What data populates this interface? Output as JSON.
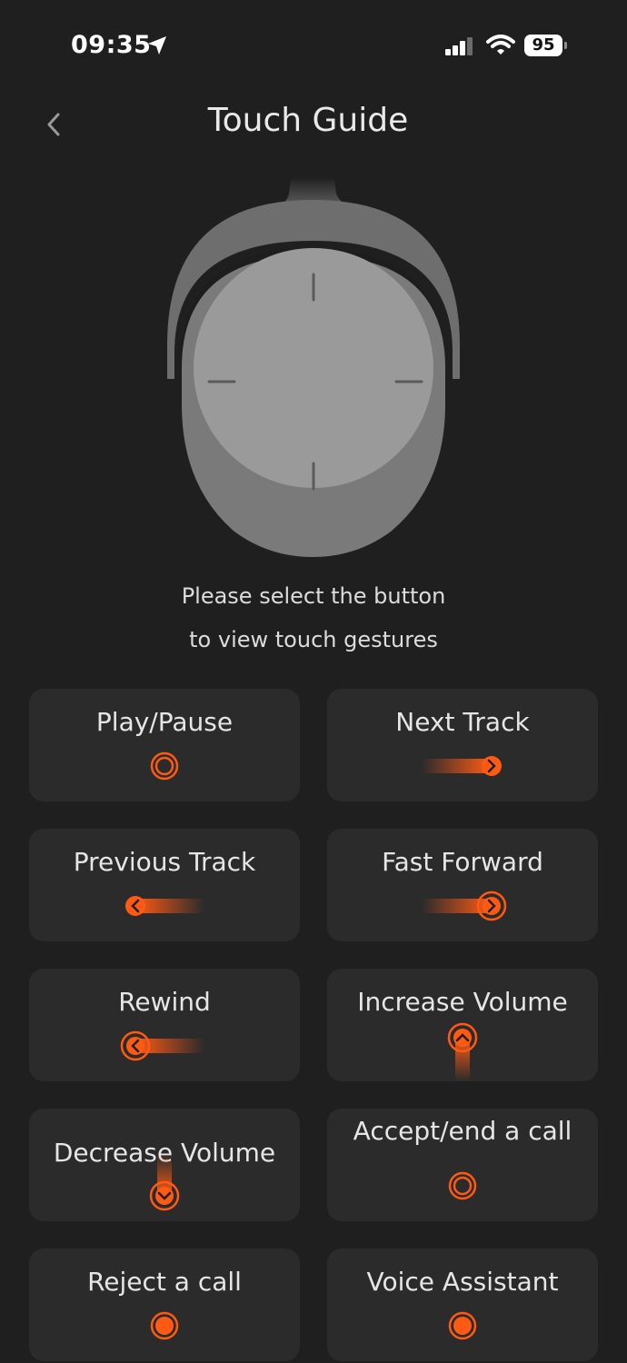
{
  "status_bar": {
    "time": "09:35",
    "battery": "95"
  },
  "header": {
    "title": "Touch Guide"
  },
  "hint": {
    "line1": "Please select the button",
    "line2": "to view touch gestures"
  },
  "gestures": [
    {
      "label": "Play/Pause",
      "icon": "ring-icon"
    },
    {
      "label": "Next Track",
      "icon": "swipe-right-icon"
    },
    {
      "label": "Previous Track",
      "icon": "swipe-left-icon"
    },
    {
      "label": "Fast Forward",
      "icon": "swipe-right-hold-icon"
    },
    {
      "label": "Rewind",
      "icon": "swipe-left-hold-icon"
    },
    {
      "label": "Increase Volume",
      "icon": "swipe-up-icon"
    },
    {
      "label": "Decrease Volume",
      "icon": "swipe-down-icon"
    },
    {
      "label": "Accept/end a call",
      "icon": "ring-icon"
    },
    {
      "label": "Reject a call",
      "icon": "dot-icon"
    },
    {
      "label": "Voice Assistant",
      "icon": "dot-icon"
    }
  ],
  "colors": {
    "accent": "#ff5a14",
    "background": "#1f1f1f",
    "card": "#2b2b2b"
  }
}
